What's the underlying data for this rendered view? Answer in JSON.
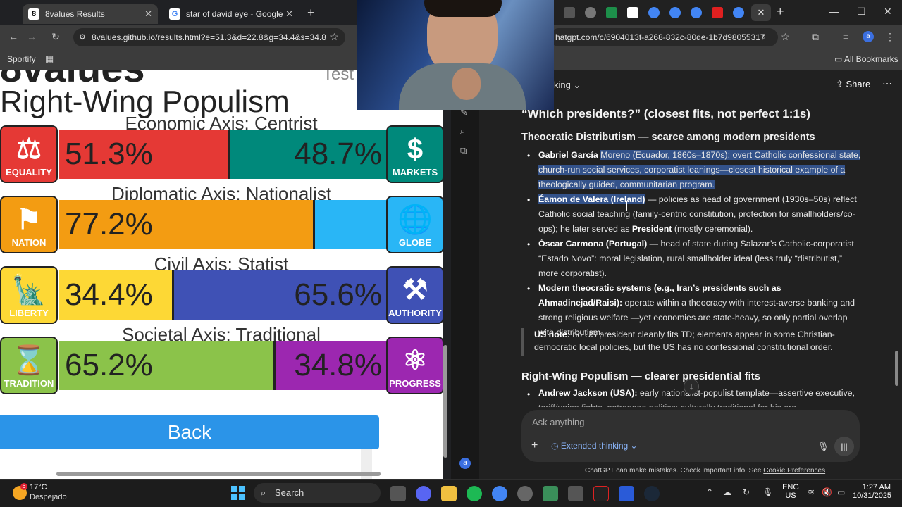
{
  "left_browser": {
    "tabs": [
      {
        "label": "8values Results",
        "favicon": "8"
      },
      {
        "label": "star of david eye - Google Sear"
      }
    ],
    "url": "8values.github.io/results.html?e=51.3&d=22.8&g=34.4&s=34.8",
    "bookmark": "Sportify"
  },
  "values_page": {
    "title_partial": "8values",
    "test_partial": "Test",
    "ideology": "Right-Wing Populism",
    "axes": [
      {
        "label": "Economic Axis: Centrist",
        "left_icon": "EQUALITY",
        "right_icon": "MARKETS",
        "left_value": "51.3%",
        "right_value": "48.7%",
        "left_fraction": 0.513,
        "left_color": "#e53935",
        "right_color": "#00897b",
        "left_icon_color": "#e53935",
        "right_icon_color": "#00897b"
      },
      {
        "label": "Diplomatic Axis: Nationalist",
        "left_icon": "NATION",
        "right_icon": "GLOBE",
        "left_value": "77.2%",
        "right_value": "",
        "left_fraction": 0.772,
        "left_color": "#f39c12",
        "right_color": "#29b6f6",
        "left_icon_color": "#f39c12",
        "right_icon_color": "#29b6f6"
      },
      {
        "label": "Civil Axis: Statist",
        "left_icon": "LIBERTY",
        "right_icon": "AUTHORITY",
        "left_value": "34.4%",
        "right_value": "65.6%",
        "left_fraction": 0.344,
        "left_color": "#fdd835",
        "right_color": "#3f51b5",
        "left_icon_color": "#fdd835",
        "right_icon_color": "#3f51b5"
      },
      {
        "label": "Societal Axis: Traditional",
        "left_icon": "TRADITION",
        "right_icon": "PROGRESS",
        "left_value": "65.2%",
        "right_value": "34.8%",
        "left_fraction": 0.652,
        "left_color": "#8bc34a",
        "right_color": "#9c27b0",
        "left_icon_color": "#8bc34a",
        "right_icon_color": "#9c27b0"
      }
    ],
    "back_label": "Back"
  },
  "right_browser": {
    "url": "hatgpt.com/c/6904013f-a268-832c-80de-1b7d98055317",
    "all_bookmarks": "All Bookmarks",
    "model_partial": "king",
    "share": "Share"
  },
  "chat": {
    "h1": "“Which presidents?” (closest fits, not perfect 1:1s)",
    "h2a": "Theocratic Distributism — scarce among modern presidents",
    "b1_name": "Gabriel García",
    "b1_hl": "Moreno (Ecuador, 1860s–1870s): overt Catholic confessional state, church-run social services, corporatist leanings—closest historical example of a theologically guided, communitarian program.",
    "b2_name": "Éamon de Valera (Ireland)",
    "b2_text": " — policies as head of government (1930s–50s) reflect Catholic social teaching (family-centric constitution, protection for smallholders/co-ops); he later served as ",
    "b2_bold": "President",
    "b2_tail": " (mostly ceremonial).",
    "b3_name": "Óscar Carmona (Portugal)",
    "b3_text": " — head of state during Salazar’s Catholic-corporatist “Estado Novo”: moral legislation, rural smallholder ideal (less truly “distributist,” more corporatist).",
    "b4_name": "Modern theocratic systems (e.g., Iran’s presidents such as Ahmadinejad/Raisi):",
    "b4_text": " operate within a theocracy with interest-averse banking and strong religious welfare —yet economies are state-heavy, so only partial overlap with distributism.",
    "note_label": "US note:",
    "note_text": " no US president cleanly fits TD; elements appear in some Christian-democratic local policies, but the US has no confessional constitutional order.",
    "h2b": "Right-Wing Populism — clearer presidential fits",
    "b5_name": "Andrew Jackson (USA):",
    "b5_text": " early nationalist-populist template—assertive executive,",
    "b5_cut": "tariff/union fights, patronage politics; culturally traditional for his era.",
    "ask_placeholder": "Ask anything",
    "extended": "Extended thinking",
    "disclaimer": "ChatGPT can make mistakes. Check important info. See ",
    "disclaimer_link": "Cookie Preferences",
    "avatar": "a"
  },
  "taskbar": {
    "temp": "17°C",
    "weather": "Despejado",
    "weather_badge": "6",
    "search": "Search",
    "lang1": "ENG",
    "lang2": "US",
    "time": "1:27 AM",
    "date": "10/31/2025"
  }
}
